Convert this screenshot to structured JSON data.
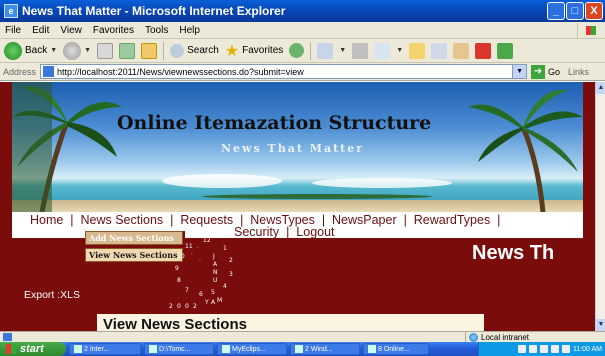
{
  "window": {
    "title": "News That Matter - Microsoft Internet Explorer",
    "buttons": [
      "_",
      "□",
      "X"
    ]
  },
  "menubar": [
    "File",
    "Edit",
    "View",
    "Favorites",
    "Tools",
    "Help"
  ],
  "toolbar": {
    "back_label": "Back",
    "search_label": "Search",
    "favorites_label": "Favorites"
  },
  "address": {
    "label": "Address",
    "url": "http://localhost:2011/News/viewnewssections.do?submit=view",
    "go_label": "Go",
    "links_label": "Links"
  },
  "page": {
    "banner_title": "Online Itemazation Structure",
    "banner_subtitle": "News That Matter",
    "nav_row1": [
      "Home",
      "News Sections",
      "Requests",
      "NewsTypes",
      "NewsPaper",
      "RewardTypes"
    ],
    "nav_row2": [
      "Security",
      "Logout"
    ],
    "dropdown": [
      "Add News Sections",
      "View News Sections"
    ],
    "clock_digits": [
      "1",
      "2",
      "3",
      "4",
      "5",
      "6",
      "7",
      "8",
      "9",
      "10",
      "11",
      "12",
      "2",
      "0",
      "0",
      "2",
      "M",
      "A",
      "Y",
      "J",
      "A",
      "N",
      "U"
    ],
    "marquee": "News Th",
    "export_label": "Export :XLS",
    "heading": "View News Sections"
  },
  "statusbar": {
    "zone": "Local intranet"
  },
  "taskbar": {
    "start_label": "start",
    "tasks": [
      "2 Inter...",
      "D:\\Tomc...",
      "MyEclips...",
      "2 Wind...",
      "8 Online..."
    ],
    "clock": "11:00 AM"
  },
  "colors": {
    "page_background": "#7b0c0c",
    "nav_text": "#6a0f0f",
    "titlebar": "#0842b0"
  }
}
